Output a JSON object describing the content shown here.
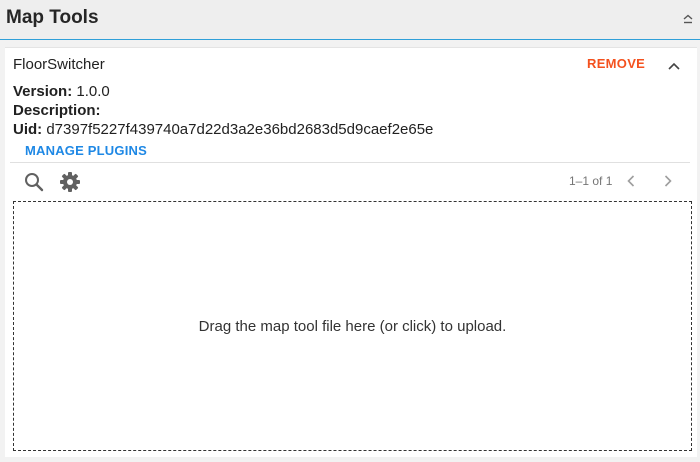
{
  "panel": {
    "title": "Map Tools"
  },
  "plugin": {
    "name": "FloorSwitcher",
    "remove_label": "REMOVE",
    "version_label": "Version:",
    "version_value": " 1.0.0",
    "description_label": "Description:",
    "description_value": "",
    "uid_label": "Uid:",
    "uid_value": " d7397f5227f439740a7d22d3a2e36bd2683d5d9caef2e65e",
    "manage_label": "MANAGE PLUGINS"
  },
  "toolbar": {
    "icons": [
      "search-icon",
      "gear-icon"
    ],
    "pager_text": "1–1 of 1"
  },
  "dropzone": {
    "text": "Drag the map tool file here (or click) to upload."
  },
  "colors": {
    "accent": "#2f9fd8",
    "remove": "#f4511e",
    "link": "#1e88e5"
  }
}
